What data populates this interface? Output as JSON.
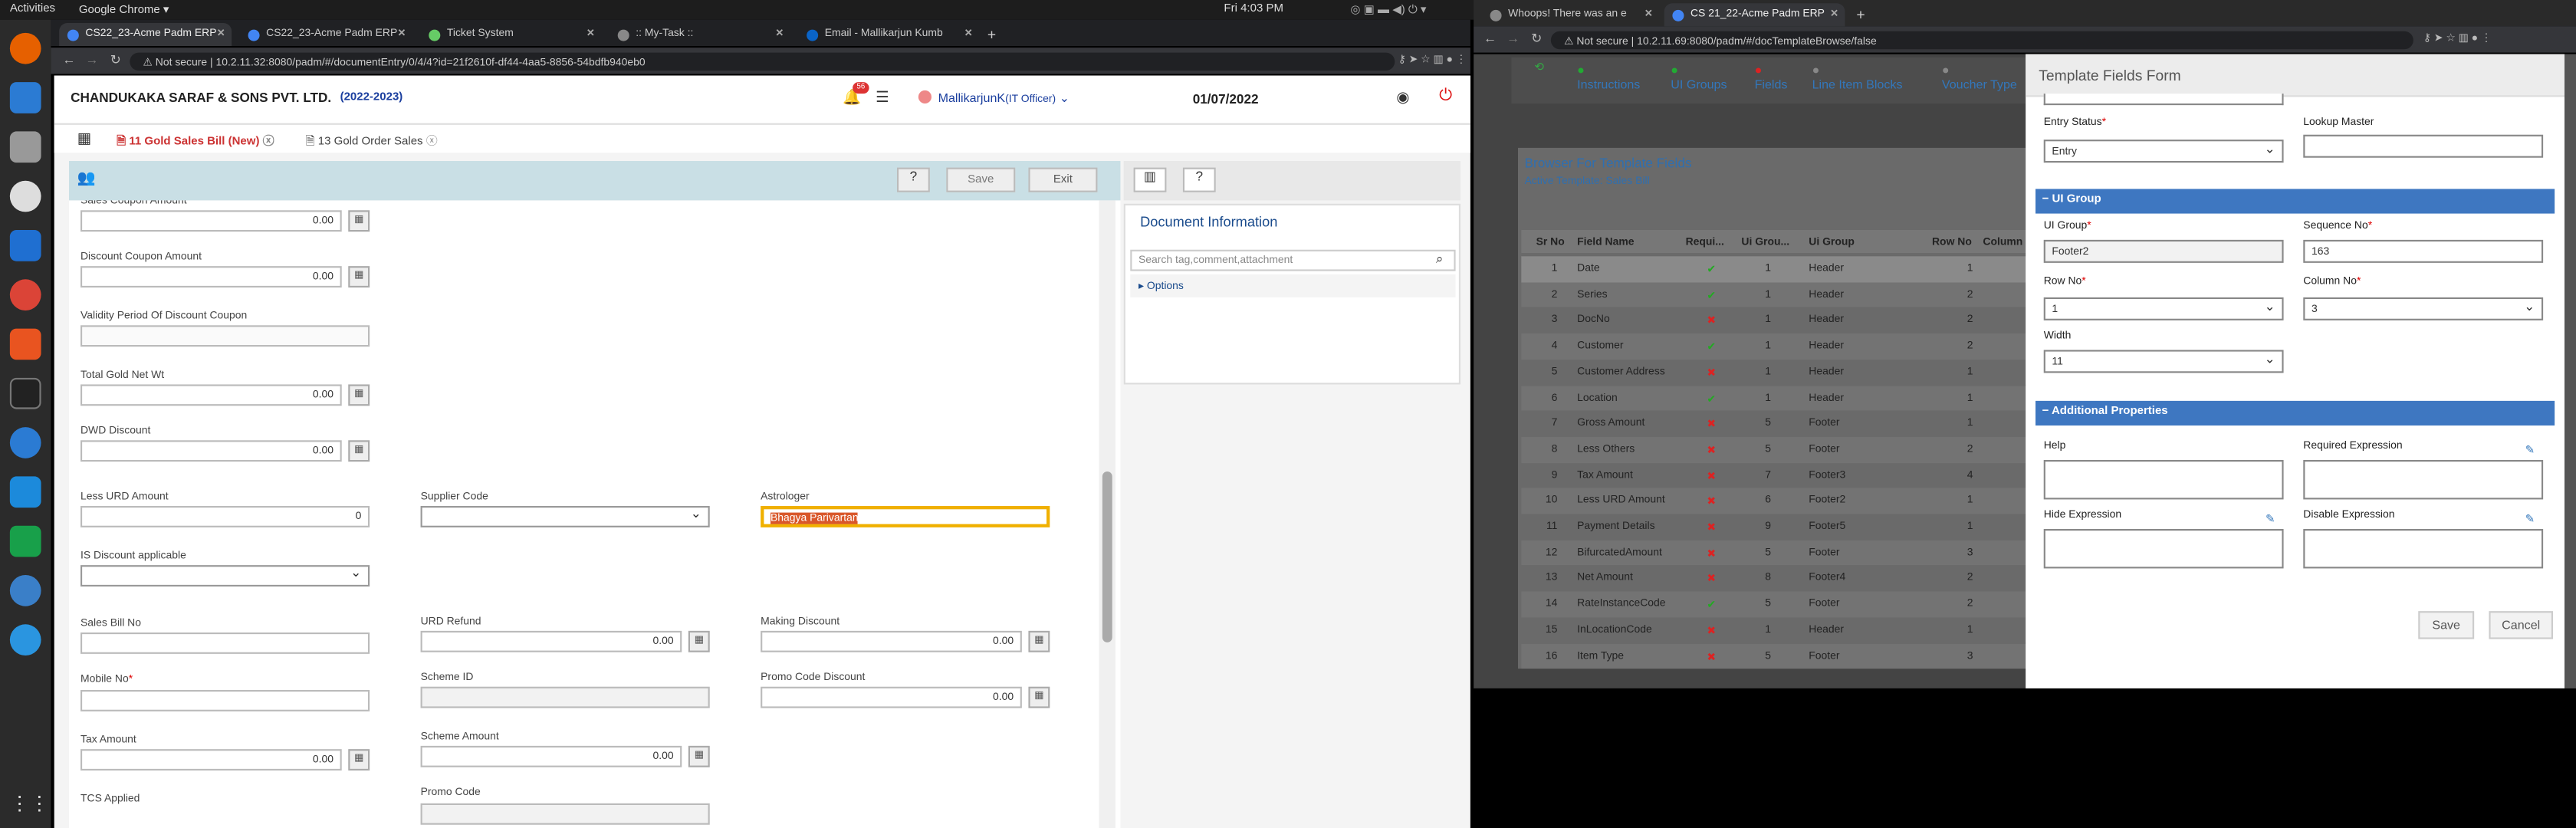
{
  "topbar": {
    "activities": "Activities",
    "app": "Google Chrome ▾",
    "clock": "Fri  4:03 PM"
  },
  "left_browser": {
    "tabs": [
      "CS22_23-Acme Padm ERP",
      "CS22_23-Acme Padm ERP",
      "Ticket System",
      ":: My-Task ::",
      "Email - Mallikarjun Kumb"
    ],
    "url": "10.2.11.32:8080/padm/#/documentEntry/0/4/4?id=21f2610f-df44-4aa5-8856-54bdfb940eb0",
    "not_secure": "Not secure"
  },
  "header": {
    "company": "CHANDUKAKA SARAF & SONS PVT. LTD.",
    "year": "(2022-2023)",
    "notif_count": "56",
    "user": "MallikarjunK",
    "role": "(IT Officer)",
    "date": "01/07/2022"
  },
  "doc_tabs": [
    "11 Gold Sales Bill (New)",
    "13 Gold Order Sales"
  ],
  "toolbar": {
    "save": "Save",
    "exit": "Exit"
  },
  "form": {
    "sales_coupon": {
      "label": "Sales Coupon Amount",
      "value": "0.00"
    },
    "discount_coupon": {
      "label": "Discount Coupon Amount",
      "value": "0.00"
    },
    "validity": {
      "label": "Validity Period Of Discount Coupon"
    },
    "total_gold": {
      "label": "Total Gold Net Wt",
      "value": "0.00"
    },
    "dwd": {
      "label": "DWD Discount",
      "value": "0.00"
    },
    "less_urd": {
      "label": "Less URD Amount",
      "value": "0"
    },
    "supplier_code": {
      "label": "Supplier Code"
    },
    "astrologer": {
      "label": "Astrologer",
      "value": "Bhagya Parivartan"
    },
    "is_discount": {
      "label": "IS Discount applicable"
    },
    "sales_bill_no": {
      "label": "Sales Bill No"
    },
    "urd_refund": {
      "label": "URD Refund",
      "value": "0.00"
    },
    "making_discount": {
      "label": "Making Discount",
      "value": "0.00"
    },
    "mobile_no": {
      "label": "Mobile No"
    },
    "scheme_id": {
      "label": "Scheme ID"
    },
    "promo_code_discount": {
      "label": "Promo Code Discount",
      "value": "0.00"
    },
    "tax_amount": {
      "label": "Tax Amount",
      "value": "0.00"
    },
    "scheme_amount": {
      "label": "Scheme Amount",
      "value": "0.00"
    },
    "tcs_applied": {
      "label": "TCS Applied"
    },
    "promo_code": {
      "label": "Promo Code"
    }
  },
  "doc_info": {
    "title": "Document Information",
    "search_placeholder": "Search tag,comment,attachment",
    "options": "Options"
  },
  "right_browser": {
    "tabs": [
      "Whoops! There was an e",
      "CS 21_22-Acme Padm ERP"
    ],
    "url": "10.2.11.69:8080/padm/#/docTemplateBrowse/false",
    "not_secure": "Not secure"
  },
  "steps": [
    "Instructions",
    "UI Groups",
    "Fields",
    "Line Item Blocks",
    "Voucher Type"
  ],
  "browser_panel": {
    "title": "Browser For Template Fields",
    "subtitle": "Active Template: Sales Bill",
    "columns": [
      "Sr No",
      "Field Name",
      "Requi...",
      "Ui Grou...",
      "Ui Group",
      "Row No",
      "Column"
    ],
    "rows": [
      [
        "1",
        "Date",
        "y",
        "1",
        "Header",
        "1"
      ],
      [
        "2",
        "Series",
        "y",
        "1",
        "Header",
        "2"
      ],
      [
        "3",
        "DocNo",
        "n",
        "1",
        "Header",
        "2"
      ],
      [
        "4",
        "Customer",
        "y",
        "1",
        "Header",
        "2"
      ],
      [
        "5",
        "Customer Address",
        "n",
        "1",
        "Header",
        "1"
      ],
      [
        "6",
        "Location",
        "y",
        "1",
        "Header",
        "1"
      ],
      [
        "7",
        "Gross Amount",
        "n",
        "5",
        "Footer",
        "1"
      ],
      [
        "8",
        "Less Others",
        "n",
        "5",
        "Footer",
        "2"
      ],
      [
        "9",
        "Tax Amount",
        "n",
        "7",
        "Footer3",
        "4"
      ],
      [
        "10",
        "Less URD Amount",
        "n",
        "6",
        "Footer2",
        "1"
      ],
      [
        "11",
        "Payment Details",
        "n",
        "9",
        "Footer5",
        "1"
      ],
      [
        "12",
        "BifurcatedAmount",
        "n",
        "5",
        "Footer",
        "3"
      ],
      [
        "13",
        "Net Amount",
        "n",
        "8",
        "Footer4",
        "2"
      ],
      [
        "14",
        "RateInstanceCode",
        "y",
        "5",
        "Footer",
        "2"
      ],
      [
        "15",
        "InLocationCode",
        "n",
        "1",
        "Header",
        "1"
      ],
      [
        "16",
        "Item Type",
        "n",
        "5",
        "Footer",
        "3"
      ]
    ]
  },
  "template_form": {
    "title": "Template Fields Form",
    "entry_status_label": "Entry Status",
    "entry_status": "Entry",
    "lookup_master": "Lookup Master",
    "ui_group_section": "UI Group",
    "ui_group_label": "UI Group",
    "ui_group": "Footer2",
    "sequence_label": "Sequence No",
    "sequence": "163",
    "row_label": "Row No",
    "row": "1",
    "column_label": "Column No",
    "column": "3",
    "width_label": "Width",
    "width": "11",
    "additional": "Additional Properties",
    "help": "Help",
    "required_expr": "Required Expression",
    "hide_expr": "Hide Expression",
    "disable_expr": "Disable Expression",
    "save": "Save",
    "cancel": "Cancel"
  }
}
